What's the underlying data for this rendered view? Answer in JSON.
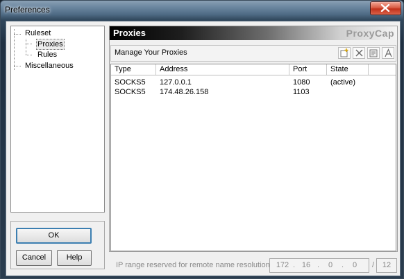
{
  "window": {
    "title": "Preferences"
  },
  "tree": {
    "items": [
      {
        "label": "Ruleset"
      },
      {
        "label": "Proxies",
        "selected": true
      },
      {
        "label": "Rules"
      },
      {
        "label": "Miscellaneous"
      }
    ]
  },
  "buttons": {
    "ok": "OK",
    "cancel": "Cancel",
    "help": "Help"
  },
  "panel": {
    "title": "Proxies",
    "brand": "ProxyCap",
    "subheader": "Manage Your Proxies",
    "toolbar_icons": [
      "new-proxy-icon",
      "delete-icon",
      "properties-icon",
      "rename-icon"
    ]
  },
  "list": {
    "columns": [
      "Type",
      "Address",
      "Port",
      "State"
    ],
    "rows": [
      {
        "type": "SOCKS5",
        "address": "127.0.0.1",
        "port": "1080",
        "state": "(active)"
      },
      {
        "type": "SOCKS5",
        "address": "174.48.26.158",
        "port": "1103",
        "state": ""
      }
    ]
  },
  "footer": {
    "label": "IP range reserved for remote name resolution:",
    "ip": [
      "172",
      "16",
      "0",
      "0"
    ],
    "slash": "/",
    "mask": "12"
  },
  "colors": {
    "title_bar": "#4e6a84",
    "panel_header": "#000000",
    "close_button": "#c2311a"
  }
}
